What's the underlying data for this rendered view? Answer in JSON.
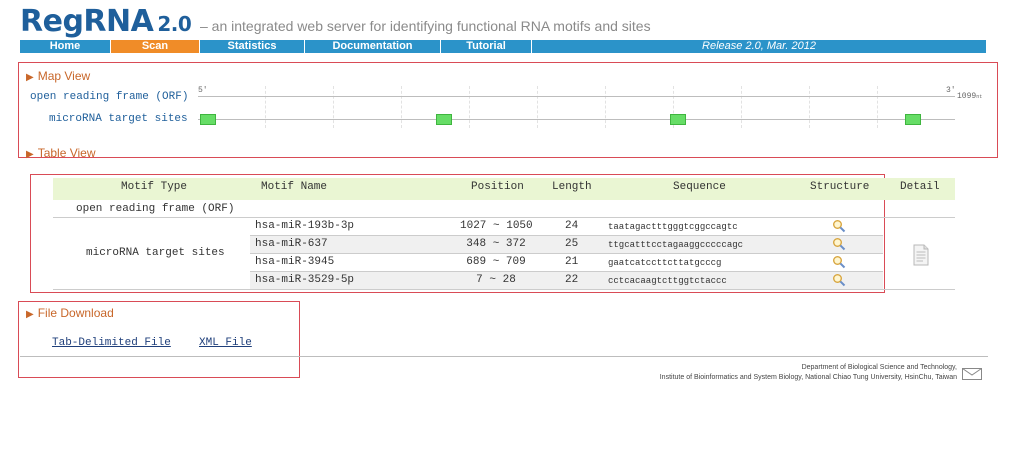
{
  "header": {
    "logo": "RegRNA",
    "version": "2.0",
    "tagline": "– an integrated web server for identifying functional RNA motifs and sites"
  },
  "nav": {
    "items": [
      "Home",
      "Scan",
      "Statistics",
      "Documentation",
      "Tutorial"
    ],
    "active": "Scan",
    "release": "Release 2.0, Mar. 2012"
  },
  "map_view": {
    "title": "Map View",
    "tracks": [
      "open reading frame (ORF)",
      "microRNA target sites"
    ],
    "start_label": "5'",
    "end_label": "3'",
    "length_label": "1099",
    "length_unit": "nt"
  },
  "table_view": {
    "title": "Table View",
    "columns": [
      "Motif Type",
      "Motif Name",
      "Position",
      "Length",
      "Sequence",
      "Structure",
      "Detail"
    ],
    "orf_label": "open reading frame (ORF)",
    "mirna_label": "microRNA target sites",
    "rows": [
      {
        "name": "hsa-miR-193b-3p",
        "start": "1027",
        "end": "1050",
        "sep": "~",
        "length": "24",
        "sequence": "taatagactttgggtcggccagtc"
      },
      {
        "name": "hsa-miR-637",
        "start": "348",
        "end": "372",
        "sep": "~",
        "length": "25",
        "sequence": "ttgcatttcctagaaggcccccagc"
      },
      {
        "name": "hsa-miR-3945",
        "start": "689",
        "end": "709",
        "sep": "~",
        "length": "21",
        "sequence": "gaatcatccttcttatgcccg"
      },
      {
        "name": "hsa-miR-3529-5p",
        "start": "7",
        "end": "28",
        "sep": "~",
        "length": "22",
        "sequence": "cctcacaagtcttggtctaccc"
      }
    ]
  },
  "file_download": {
    "title": "File Download",
    "links": [
      "Tab-Delimited File",
      "XML File"
    ]
  },
  "footer": {
    "line1": "Department of Biological Science and Technology,",
    "line2": "Institute of Bioinformatics and System Biology, National Chiao Tung University, HsinChu, Taiwan"
  },
  "colors": {
    "brand": "#1f5f9b",
    "nav": "#2b93c9",
    "nav_active": "#f08c28",
    "section_title": "#c8672a",
    "box_border": "#d94b56",
    "target_site": "#66dd66",
    "table_header": "#eaf6d3"
  },
  "icons": [
    "magnifier-icon",
    "document-icon",
    "mail-icon"
  ]
}
